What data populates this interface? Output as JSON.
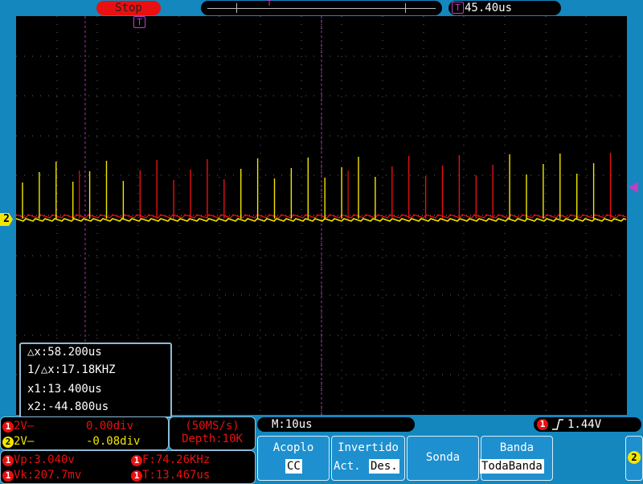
{
  "top": {
    "status": "Stop",
    "trigger_time_icon": "T",
    "trigger_time": "45.40us",
    "timeline_marker": "T"
  },
  "markers": {
    "ch2_label": "2",
    "trigger_pos_label": "T"
  },
  "cursor": {
    "delta_x": "△x:58.200us",
    "inv_delta_x": "1/△x:17.18KHZ",
    "x1": "x1:13.400us",
    "x2": "x2:-44.800us"
  },
  "channels": [
    {
      "num": "1",
      "volts": "2V‒",
      "offset": "0.00div",
      "color": "#e81010",
      "badge_color": "#e81010"
    },
    {
      "num": "2",
      "volts": "2V‒",
      "offset": "-0.08div",
      "color": "#f2e600",
      "badge_color": "#f2e600"
    }
  ],
  "sampling": {
    "rate": "(50MS/s)",
    "depth": "Depth:10K"
  },
  "measurements": [
    {
      "num": "1",
      "text": "Vp:3.040v"
    },
    {
      "num": "1",
      "text": "F:74.26KHz"
    },
    {
      "num": "1",
      "text": "Vk:207.7mv"
    },
    {
      "num": "1",
      "text": "T:13.467us"
    }
  ],
  "timebase": "M:10us",
  "trigger": {
    "channel": "1",
    "level": "1.44V"
  },
  "menu": {
    "acoplo": {
      "title": "Acoplo",
      "value": "CC"
    },
    "invertido": {
      "title": "Invertido",
      "act": "Act.",
      "des": "Des."
    },
    "sonda": {
      "title": "Sonda"
    },
    "banda": {
      "title": "Banda",
      "value": "TodaBanda"
    },
    "side_channel": "2"
  },
  "colors": {
    "ch1": "#e81010",
    "ch2": "#f2e600",
    "trigger": "#c040c0",
    "background": "#1487bf"
  },
  "icons": {
    "trigger_edge": "rising-edge-icon"
  }
}
